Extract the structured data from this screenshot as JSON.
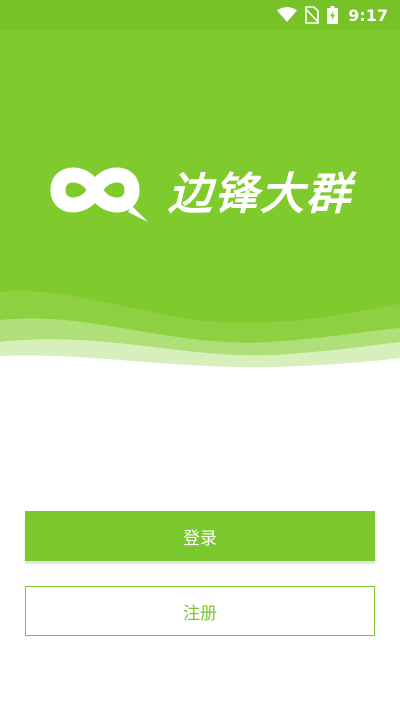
{
  "status_bar": {
    "time": "9:17",
    "icons": [
      "wifi-icon",
      "no-sim-icon",
      "battery-charging-icon"
    ]
  },
  "app": {
    "brand_name": "边锋大群",
    "logo_icon": "infinity-chat-logo"
  },
  "actions": {
    "login_label": "登录",
    "register_label": "注册"
  },
  "colors": {
    "accent": "#7fcb2e",
    "status_bar": "#77c226",
    "button": "#7ac82b"
  }
}
